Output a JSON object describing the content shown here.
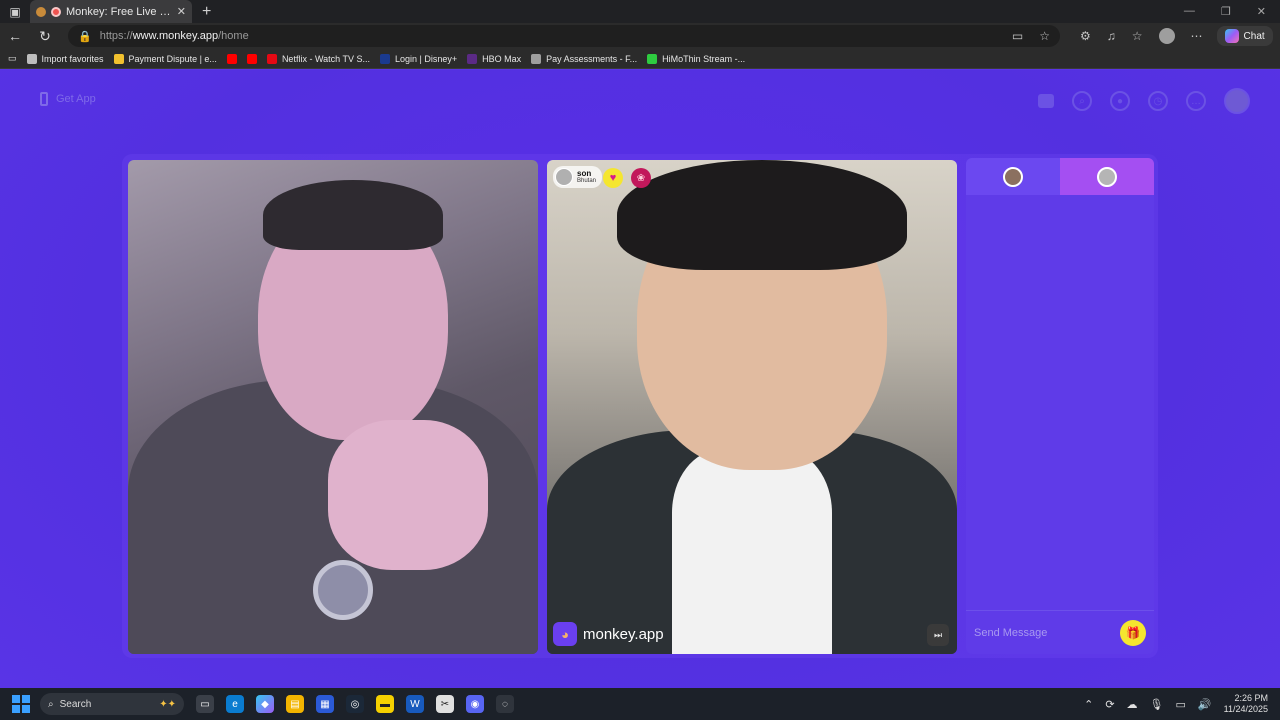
{
  "browser": {
    "tab_title": "Monkey: Free Live Video Ch...",
    "url_scheme": "https://",
    "url_host": "www.monkey.app",
    "url_path": "/home",
    "chat_label": "Chat"
  },
  "bookmarks": [
    {
      "label": "Import favorites",
      "color": "#bdbdbd"
    },
    {
      "label": "Payment Dispute | e...",
      "color": "#f2c12e"
    },
    {
      "label": "",
      "color": "#ff0000"
    },
    {
      "label": "",
      "color": "#ff0000"
    },
    {
      "label": "Netflix - Watch TV S...",
      "color": "#e50914"
    },
    {
      "label": "Login | Disney+",
      "color": "#1a3a8f"
    },
    {
      "label": "HBO Max",
      "color": "#5b2a86"
    },
    {
      "label": "Pay Assessments - F...",
      "color": "#9e9e9e"
    },
    {
      "label": "HiMoThin Stream -...",
      "color": "#2ecc40"
    }
  ],
  "app": {
    "get_app_label": "Get App",
    "remote_user": {
      "name": "son",
      "country": "Bhutan"
    },
    "brand_label": "monkey.app",
    "message_placeholder": "Send Message"
  },
  "taskbar": {
    "search_label": "Search",
    "time": "2:26 PM",
    "date": "11/24/2025"
  }
}
